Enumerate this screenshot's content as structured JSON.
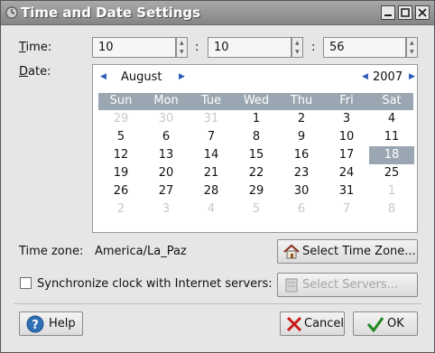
{
  "window": {
    "title": "Time and Date Settings"
  },
  "time": {
    "label": "Time:",
    "hours": "10",
    "minutes": "10",
    "seconds": "56",
    "separator": ":"
  },
  "date": {
    "label": "Date:",
    "month": "August",
    "year": "2007",
    "weekdays": [
      "Sun",
      "Mon",
      "Tue",
      "Wed",
      "Thu",
      "Fri",
      "Sat"
    ],
    "weeks": [
      [
        "29",
        "30",
        "31",
        "1",
        "2",
        "3",
        "4"
      ],
      [
        "5",
        "6",
        "7",
        "8",
        "9",
        "10",
        "11"
      ],
      [
        "12",
        "13",
        "14",
        "15",
        "16",
        "17",
        "18"
      ],
      [
        "19",
        "20",
        "21",
        "22",
        "23",
        "24",
        "25"
      ],
      [
        "26",
        "27",
        "28",
        "29",
        "30",
        "31",
        "1"
      ],
      [
        "2",
        "3",
        "4",
        "5",
        "6",
        "7",
        "8"
      ]
    ],
    "outside_month_cells": [
      [
        0,
        0
      ],
      [
        0,
        1
      ],
      [
        0,
        2
      ],
      [
        4,
        6
      ],
      [
        5,
        0
      ],
      [
        5,
        1
      ],
      [
        5,
        2
      ],
      [
        5,
        3
      ],
      [
        5,
        4
      ],
      [
        5,
        5
      ],
      [
        5,
        6
      ]
    ],
    "selected_cell": [
      2,
      6
    ]
  },
  "timezone": {
    "label": "Time zone:",
    "value": "America/La_Paz",
    "button": "Select Time Zone..."
  },
  "sync": {
    "label": "Synchronize clock with Internet servers:",
    "checked": false,
    "button": "Select Servers..."
  },
  "footer": {
    "help": "Help",
    "cancel": "Cancel",
    "ok": "OK"
  },
  "colors": {
    "calendar_header": "#9aa6b1",
    "selected_day": "#9aa6b1",
    "titlebar": "#979797"
  }
}
